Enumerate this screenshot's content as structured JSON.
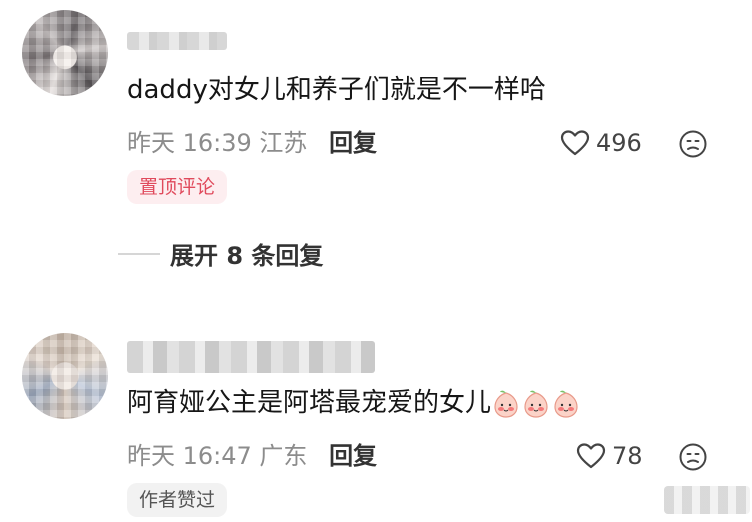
{
  "comments": [
    {
      "text": "daddy对女儿和养子们就是不一样哈",
      "time": "昨天 16:39 江苏",
      "reply_label": "回复",
      "likes": "496",
      "badge": "置顶评论",
      "expand_label": "展开 8 条回复"
    },
    {
      "text": "阿育娅公主是阿塔最宠爱的女儿",
      "emoji": [
        "blushing-peach-emoji",
        "blushing-peach-emoji",
        "blushing-peach-emoji"
      ],
      "time": "昨天 16:47 广东",
      "reply_label": "回复",
      "likes": "78",
      "badge": "作者赞过"
    }
  ],
  "colors": {
    "pinned_badge_text": "#e04a5c",
    "pinned_badge_bg": "#fdeef0",
    "meta_text": "#8c8c8c"
  }
}
